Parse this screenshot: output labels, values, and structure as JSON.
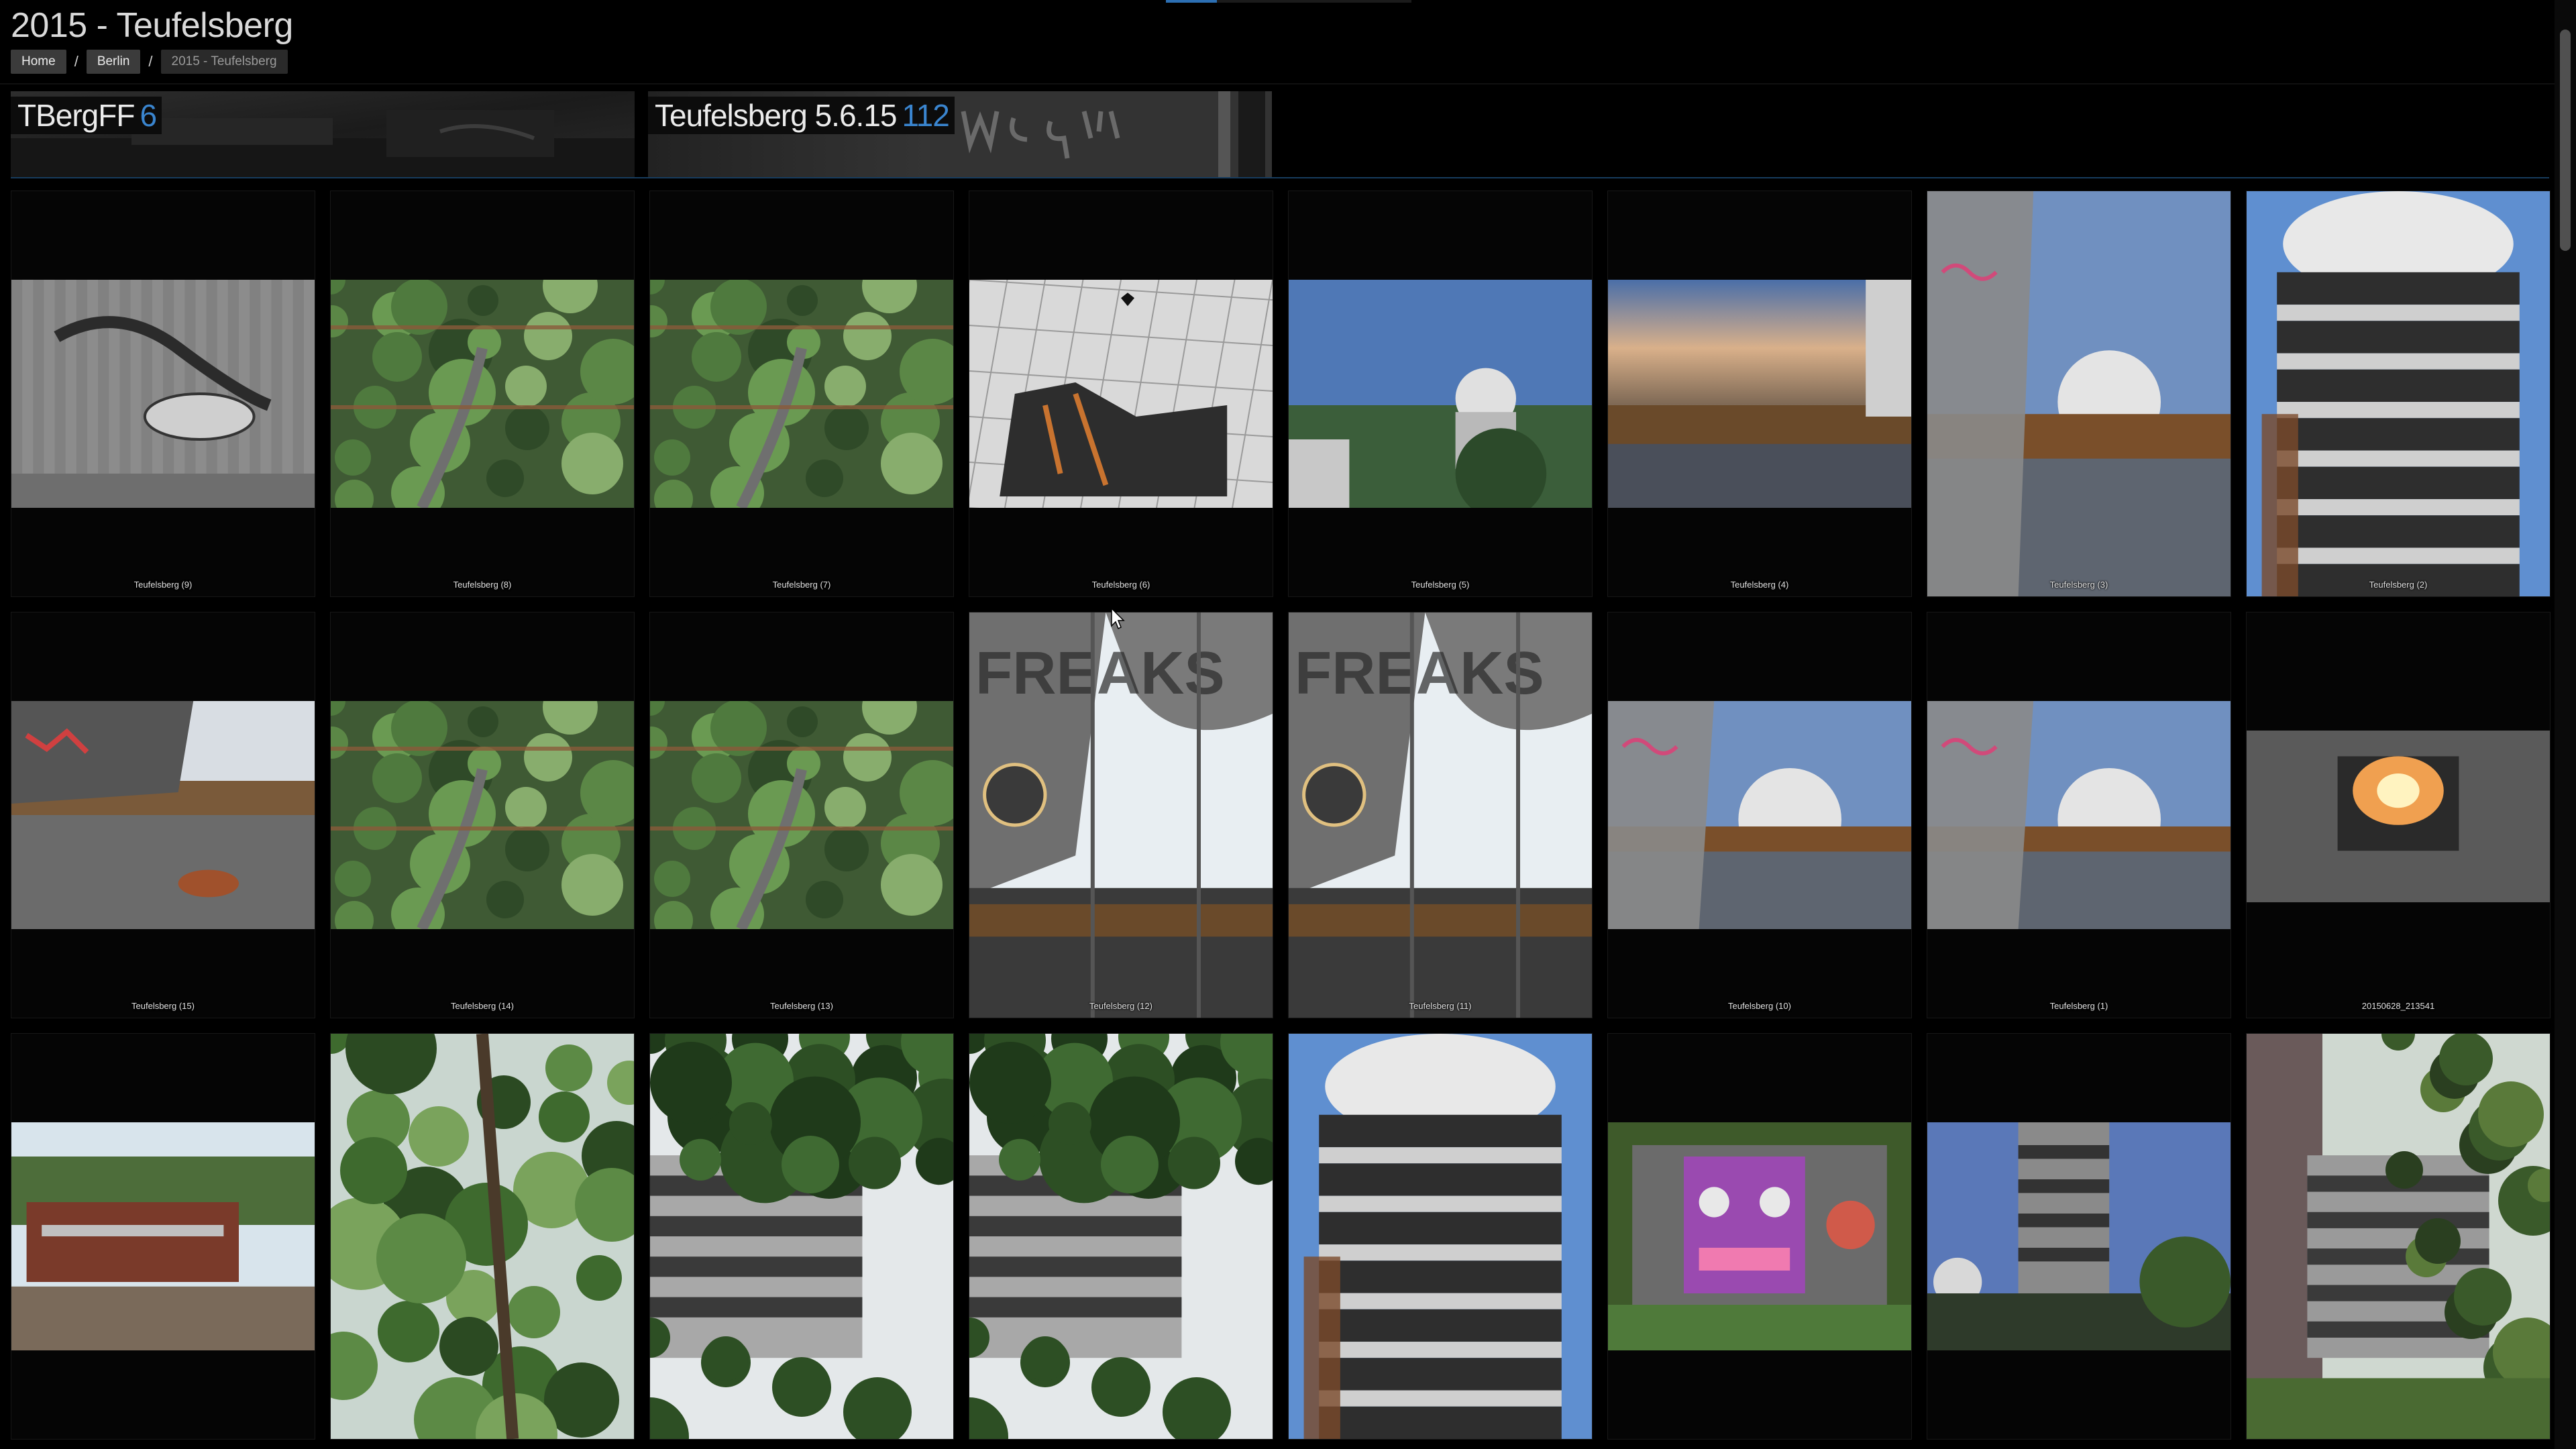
{
  "page": {
    "title": "2015 - Teufelsberg"
  },
  "breadcrumb": {
    "items": [
      {
        "label": "Home"
      },
      {
        "label": "Berlin"
      },
      {
        "label": "2015 - Teufelsberg"
      }
    ],
    "separator": "/"
  },
  "albums": [
    {
      "title": "TBergFF",
      "count": "6"
    },
    {
      "title": "Teufelsberg 5.6.15",
      "count": "112"
    }
  ],
  "photos": [
    {
      "caption": "Teufelsberg (9)",
      "orientation": "landscape",
      "scene": "graffiti-wall"
    },
    {
      "caption": "Teufelsberg (8)",
      "orientation": "landscape",
      "scene": "trees-from-above"
    },
    {
      "caption": "Teufelsberg (7)",
      "orientation": "landscape",
      "scene": "trees-from-above"
    },
    {
      "caption": "Teufelsberg (6)",
      "orientation": "landscape",
      "scene": "radome-closeup"
    },
    {
      "caption": "Teufelsberg (5)",
      "orientation": "landscape",
      "scene": "sky-radome"
    },
    {
      "caption": "Teufelsberg (4)",
      "orientation": "landscape",
      "scene": "sunset-terrace"
    },
    {
      "caption": "Teufelsberg (3)",
      "orientation": "portrait",
      "scene": "radome-terrace"
    },
    {
      "caption": "Teufelsberg (2)",
      "orientation": "portrait",
      "scene": "tower"
    },
    {
      "caption": "Teufelsberg (15)",
      "orientation": "landscape",
      "scene": "terrace-graffiti"
    },
    {
      "caption": "Teufelsberg (14)",
      "orientation": "landscape",
      "scene": "trees-from-above"
    },
    {
      "caption": "Teufelsberg (13)",
      "orientation": "landscape",
      "scene": "trees-from-above"
    },
    {
      "caption": "Teufelsberg (12)",
      "orientation": "portrait",
      "scene": "freaks-window"
    },
    {
      "caption": "Teufelsberg (11)",
      "orientation": "portrait",
      "scene": "freaks-window"
    },
    {
      "caption": "Teufelsberg (10)",
      "orientation": "landscape",
      "scene": "radome-terrace"
    },
    {
      "caption": "Teufelsberg (1)",
      "orientation": "landscape",
      "scene": "radome-terrace"
    },
    {
      "caption": "20150628_213541",
      "orientation": "landscape-wide",
      "scene": "fire"
    },
    {
      "caption": "",
      "orientation": "landscape",
      "scene": "bar-counter"
    },
    {
      "caption": "",
      "orientation": "portrait",
      "scene": "trees-up"
    },
    {
      "caption": "",
      "orientation": "portrait",
      "scene": "trees-up-building"
    },
    {
      "caption": "",
      "orientation": "portrait",
      "scene": "trees-up-building"
    },
    {
      "caption": "",
      "orientation": "portrait",
      "scene": "tower"
    },
    {
      "caption": "",
      "orientation": "landscape",
      "scene": "graffiti-face"
    },
    {
      "caption": "",
      "orientation": "landscape",
      "scene": "sky-tower"
    },
    {
      "caption": "",
      "orientation": "portrait",
      "scene": "ruin-trees"
    }
  ],
  "icons": {
    "cursor": "mouse-pointer-icon"
  },
  "colors": {
    "background": "#000000",
    "accent": "#3a85cf",
    "tile_border": "#171717"
  }
}
